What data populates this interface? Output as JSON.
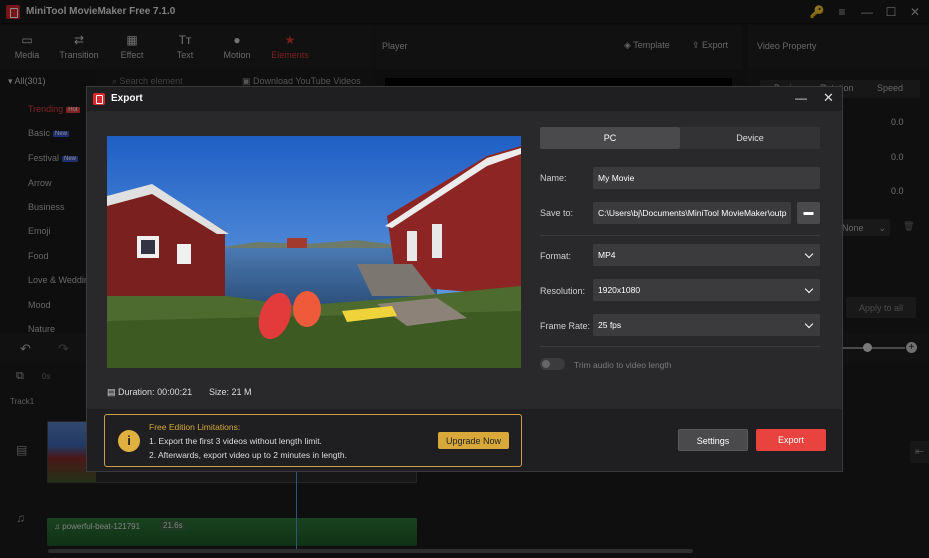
{
  "app": {
    "title": "MiniTool MovieMaker Free 7.1.0"
  },
  "window_controls": {
    "key": "🔑",
    "menu": "≡",
    "minimize": "—",
    "maximize": "☐",
    "close": "✕"
  },
  "toolbar": {
    "items": [
      {
        "label": "Media",
        "icon": "▭"
      },
      {
        "label": "Transition",
        "icon": "⇄"
      },
      {
        "label": "Effect",
        "icon": "▦"
      },
      {
        "label": "Text",
        "icon": "Tт"
      },
      {
        "label": "Motion",
        "icon": "●"
      },
      {
        "label": "Elements",
        "icon": "★"
      }
    ]
  },
  "player": {
    "title": "Player",
    "template_label": "Template",
    "export_label": "Export"
  },
  "video_property": {
    "title": "Video Property",
    "tabs": [
      "Basic",
      "Rotation",
      "Speed"
    ],
    "values": [
      "0.0",
      "0.0",
      "0.0"
    ],
    "dropdown": "None",
    "apply_label": "Apply to all"
  },
  "left_panel": {
    "all_label": "All(301)",
    "search_placeholder": "Search element",
    "download_label": "Download YouTube Videos",
    "categories": [
      {
        "label": "Trending",
        "badge": "Hot",
        "active": true
      },
      {
        "label": "Basic",
        "badge": "New"
      },
      {
        "label": "Festival",
        "badge": "New"
      },
      {
        "label": "Arrow"
      },
      {
        "label": "Business"
      },
      {
        "label": "Emoji"
      },
      {
        "label": "Food"
      },
      {
        "label": "Love & Wedding"
      },
      {
        "label": "Mood"
      },
      {
        "label": "Nature"
      }
    ]
  },
  "timeline": {
    "time_zero": "0s",
    "track_label": "Track1",
    "audio_clip_name": "powerful-beat-121791",
    "audio_clip_duration": "21.6s"
  },
  "export_dialog": {
    "title": "Export",
    "tabs": {
      "pc": "PC",
      "device": "Device"
    },
    "name_label": "Name:",
    "name_value": "My Movie",
    "save_to_label": "Save to:",
    "save_to_value": "C:\\Users\\bj\\Documents\\MiniTool MovieMaker\\outp",
    "format_label": "Format:",
    "format_value": "MP4",
    "resolution_label": "Resolution:",
    "resolution_value": "1920x1080",
    "frame_rate_label": "Frame Rate:",
    "frame_rate_value": "25 fps",
    "trim_label": "Trim audio to video length",
    "duration_label": "Duration:",
    "duration_value": "00:00:21",
    "size_label": "Size:",
    "size_value": "21 M",
    "limitations_title": "Free Edition Limitations:",
    "limitation_1": "1. Export the first 3 videos without length limit.",
    "limitation_2": "2. Afterwards, export video up to 2 minutes in length.",
    "upgrade_label": "Upgrade Now",
    "settings_label": "Settings",
    "export_label": "Export"
  },
  "colors": {
    "accent_red": "#e8433f",
    "accent_gold": "#d8a83a",
    "brand": "#d9272e"
  }
}
